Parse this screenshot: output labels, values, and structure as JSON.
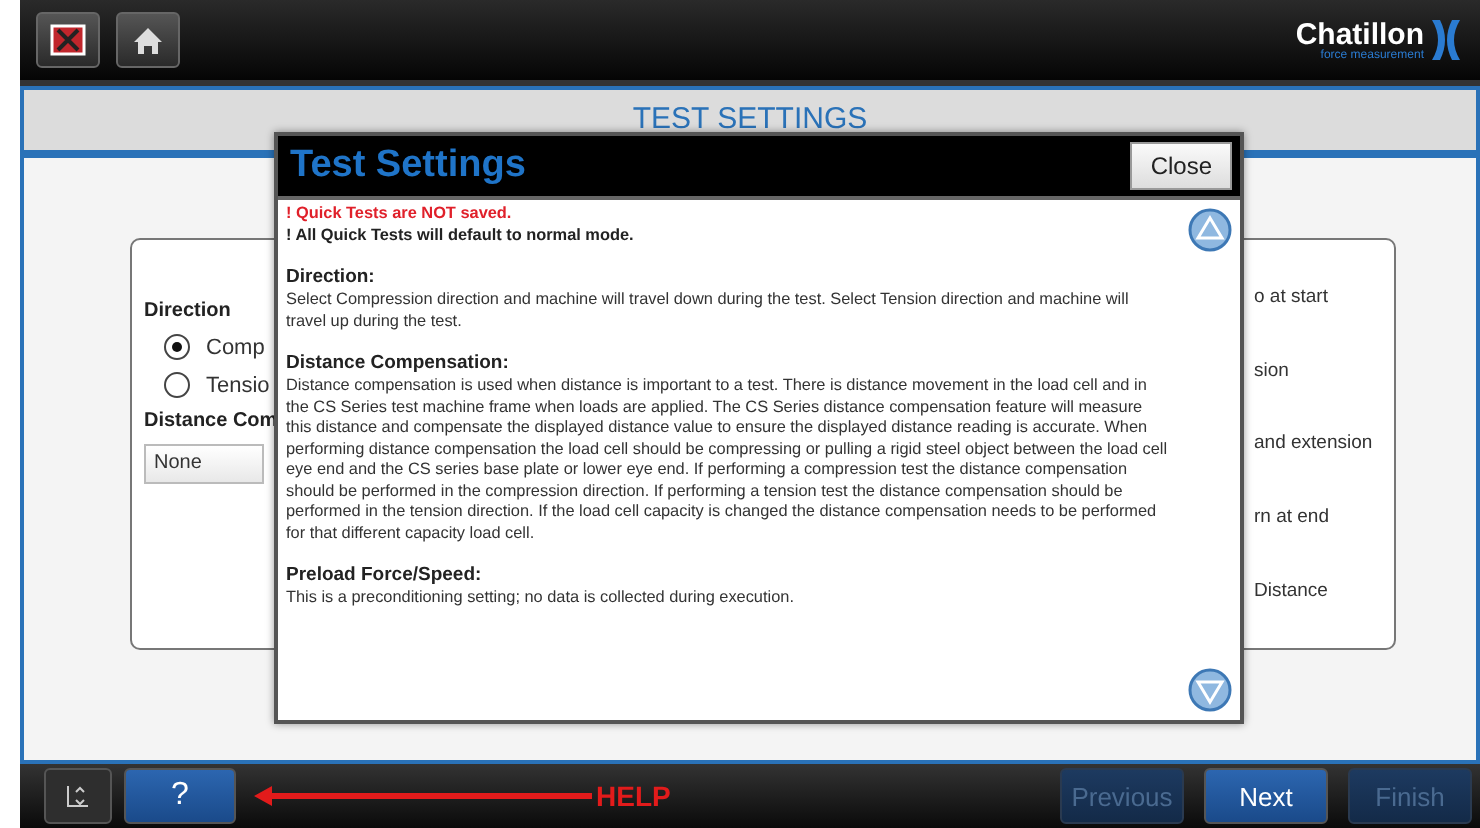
{
  "brand": {
    "name": "Chatillon",
    "tagline": "force measurement"
  },
  "page_title": "TEST SETTINGS",
  "background_form": {
    "direction_label": "Direction",
    "radios": [
      {
        "label": "Comp",
        "selected": true
      },
      {
        "label": "Tensio",
        "selected": false
      }
    ],
    "distance_label": "Distance Com",
    "dropdown_value": "None",
    "right_options": [
      "o at start",
      "sion",
      "and extension",
      "rn at end",
      "Distance"
    ]
  },
  "dialog": {
    "title": "Test Settings",
    "close": "Close",
    "notices": [
      {
        "text": "! Quick Tests are NOT saved.",
        "kind": "warning"
      },
      {
        "text": "! All Quick Tests will default to normal mode.",
        "kind": "info"
      }
    ],
    "sections": [
      {
        "heading": "Direction:",
        "body": "Select Compression direction and machine will travel down during the test. Select Tension direction and machine will travel up during the test."
      },
      {
        "heading": "Distance Compensation:",
        "body": "Distance compensation is used when distance is important to a test. There is distance movement in the load cell and in the CS Series test machine frame when loads are applied. The CS Series distance compensation feature will measure this distance and compensate the displayed distance value to ensure the displayed distance reading is accurate. When performing distance compensation the load cell should be compressing or pulling a rigid steel object between the load cell eye end and the CS series base plate or lower eye end. If performing a compression test the distance compensation should be performed in the compression direction. If performing a tension test the distance compensation should be performed in the tension direction.  If the load cell capacity is changed the distance compensation needs to be performed for that different capacity load cell."
      },
      {
        "heading": "Preload Force/Speed:",
        "body": "This is a preconditioning setting; no data is collected during execution."
      }
    ]
  },
  "bottom_bar": {
    "help": "?",
    "annotation": "HELP",
    "nav_buttons": [
      {
        "label": "Previous",
        "disabled": true
      },
      {
        "label": "Next",
        "disabled": false
      },
      {
        "label": "Finish",
        "disabled": true
      }
    ]
  }
}
